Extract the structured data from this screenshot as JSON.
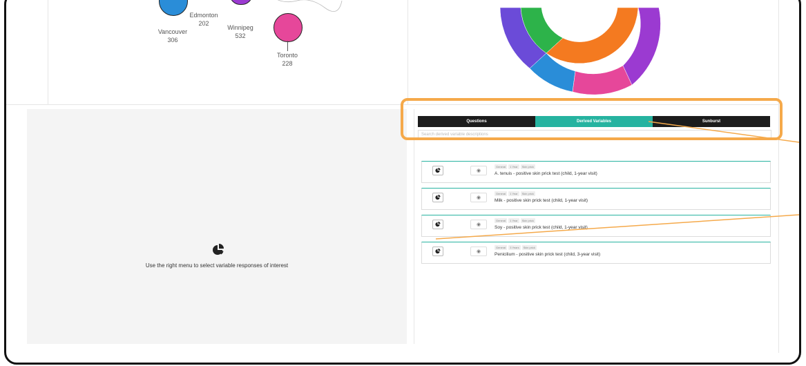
{
  "map": {
    "cities": [
      {
        "name": "Vancouver",
        "value": "306"
      },
      {
        "name": "Edmonton",
        "value": "202"
      },
      {
        "name": "Winnipeg",
        "value": "532"
      },
      {
        "name": "Toronto",
        "value": "228"
      }
    ],
    "colors": {
      "vancouver": "#2a8dd8",
      "winnipeg": "#9b3ad1",
      "toronto": "#e6479a"
    }
  },
  "sunburst_colors": [
    "#2a8dd8",
    "#2db34a",
    "#f47a20",
    "#e6479a",
    "#9b3ad1",
    "#6b4bd8"
  ],
  "hint": {
    "text": "Use the right menu to select variable responses of interest",
    "icon": "pie-chart-icon"
  },
  "tabs": [
    {
      "label": "Questions",
      "active": false
    },
    {
      "label": "Derived Variables",
      "active": true
    },
    {
      "label": "Sunburst",
      "active": false
    }
  ],
  "search": {
    "placeholder": "Search derived variable descriptions"
  },
  "items": [
    {
      "tags": [
        "General",
        "1 Year",
        "Skin prick"
      ],
      "label": "A. tenuis - positive skin prick test (child, 1-year visit)"
    },
    {
      "tags": [
        "General",
        "1 Year",
        "Skin prick"
      ],
      "label": "Milk - positive skin prick test (child, 1-year visit)"
    },
    {
      "tags": [
        "General",
        "1 Year",
        "Skin prick"
      ],
      "label": "Soy - positive skin prick test (child, 1-year visit)"
    },
    {
      "tags": [
        "General",
        "3 Years",
        "Skin prick"
      ],
      "label": "Penicilium - positive skin prick test (child, 3-year visit)"
    }
  ],
  "accent_color": "#26b3a0",
  "highlight_color": "#f5a94a"
}
